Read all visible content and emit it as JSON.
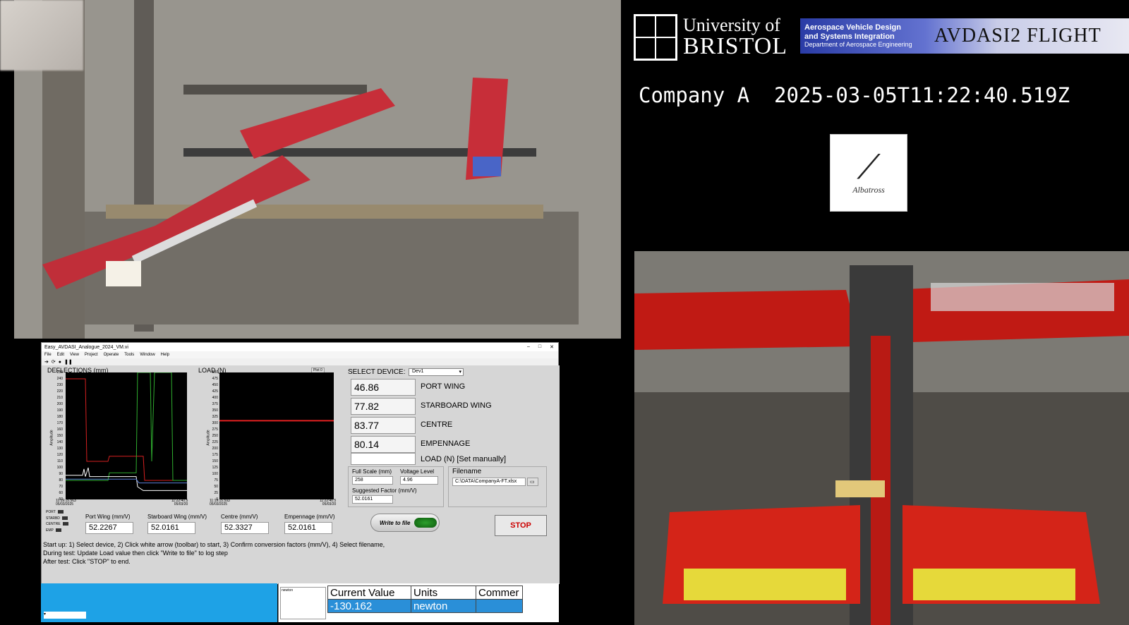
{
  "header": {
    "university_line1": "University of",
    "university_line2": "BRISTOL",
    "banner_line1": "Aerospace Vehicle Design",
    "banner_line2": "and Systems Integration",
    "banner_line3": "Department of Aerospace Engineering",
    "banner_brand": "AVDASI2 FLIGHT",
    "company_line": "Company A  2025-03-05T11:22:40.519Z",
    "albatross_word": "Albatross"
  },
  "labview": {
    "window_title": "Easy_AVDASI_Analogue_2024_VM.vi",
    "menu": [
      "File",
      "Edit",
      "View",
      "Project",
      "Operate",
      "Tools",
      "Window",
      "Help"
    ],
    "deflections_label": "DEFLECTIONS (mm)",
    "load_label": "LOAD (N)",
    "plot_button": "Plot 0",
    "select_device_label": "SELECT DEVICE:",
    "select_device_value": "Dev1",
    "readings": [
      {
        "value": "46.86",
        "label": "PORT WING"
      },
      {
        "value": "77.82",
        "label": "STARBOARD WING"
      },
      {
        "value": "83.77",
        "label": "CENTRE"
      },
      {
        "value": "80.14",
        "label": "EMPENNAGE"
      },
      {
        "value": "",
        "label": "LOAD (N) [Set manually]"
      }
    ],
    "full_scale_label": "Full Scale (mm)",
    "full_scale_value": "258",
    "voltage_label": "Voltage Level",
    "voltage_value": "4.96",
    "suggested_label": "Suggested Factor (mm/V)",
    "suggested_value": "52.0161",
    "filename_label": "Filename",
    "filename_value": "C:\\DATA\\CompanyA-FT.xlsx",
    "legend": [
      "PORT",
      "STARBD",
      "CENTRE",
      "EMP"
    ],
    "factors": [
      {
        "label": "Port Wing (mm/V)",
        "value": "52.2267"
      },
      {
        "label": "Starboard Wing (mm/V)",
        "value": "52.0161"
      },
      {
        "label": "Centre (mm/V)",
        "value": "52.3327"
      },
      {
        "label": "Empennage (mm/V)",
        "value": "52.0161"
      }
    ],
    "write_button": "Write to file",
    "stop_button": "STOP",
    "instructions": [
      "Start up: 1) Select device, 2) Click white arrow (toolbar) to start, 3) Confirm conversion factors (mm/V), 4) Select filename,",
      "During test: Update Load value then click \"Write to file\" to log step",
      "After test: Click \"STOP\" to end."
    ],
    "defl_yticks": [
      "250",
      "240",
      "230",
      "220",
      "210",
      "200",
      "190",
      "180",
      "170",
      "160",
      "150",
      "140",
      "130",
      "120",
      "110",
      "100",
      "90",
      "80",
      "70",
      "60",
      "50"
    ],
    "load_yticks": [
      "500",
      "475",
      "450",
      "425",
      "400",
      "375",
      "350",
      "325",
      "300",
      "275",
      "250",
      "225",
      "200",
      "175",
      "150",
      "125",
      "100",
      "75",
      "50",
      "25",
      "0"
    ],
    "defl_xstart": "11:19:15.563",
    "defl_xstart_date": "05/03/2025",
    "defl_xend": "11:22:40.5",
    "defl_xend_date": "05/03/20",
    "load_xstart": "11:19:15.593",
    "load_xstart_date": "05/03/2025",
    "load_xend": "11:22:40.5",
    "load_xend_date": "05/03/20",
    "y_axis_name": "Amplitude"
  },
  "table": {
    "headers": [
      "Current Value",
      "Units",
      "Commer"
    ],
    "row": [
      "-130.162",
      "newton",
      ""
    ],
    "mini_list_item": "newton"
  },
  "colors": {
    "port": "#d62020",
    "starboard": "#2fae2f",
    "centre": "#ffffff",
    "empennage": "#5b7fd8",
    "load": "#e02020"
  }
}
